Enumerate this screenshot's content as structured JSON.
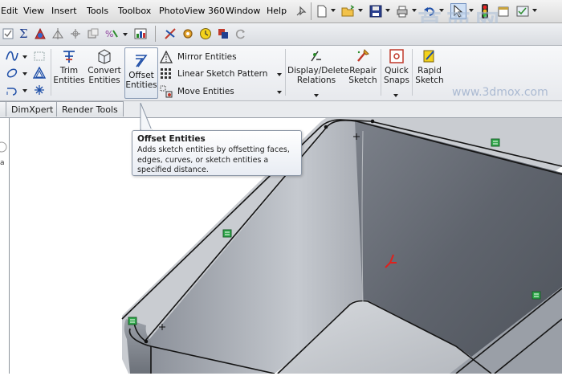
{
  "menubar": {
    "items": [
      "Edit",
      "View",
      "Insert",
      "Tools",
      "Toolbox",
      "PhotoView 360",
      "Window",
      "Help"
    ]
  },
  "command_manager": {
    "trim": [
      "Trim",
      "Entities"
    ],
    "convert": [
      "Convert",
      "Entities"
    ],
    "offset": [
      "Offset",
      "Entities"
    ],
    "mirror": "Mirror Entities",
    "linear_pattern": "Linear Sketch Pattern",
    "move": "Move Entities",
    "display_delete": [
      "Display/Delete",
      "Relations"
    ],
    "repair": [
      "Repair",
      "Sketch"
    ],
    "quick_snaps": [
      "Quick",
      "Snaps"
    ],
    "rapid": [
      "Rapid",
      "Sketch"
    ]
  },
  "tabs": [
    "DimXpert",
    "Render Tools"
  ],
  "tooltip": {
    "title": "Offset Entities",
    "body": [
      "Adds sketch entities by offsetting faces,",
      "edges, curves, or sketch entities a",
      "specified distance."
    ]
  },
  "watermark": {
    "line1": "莫西网",
    "line2": "www.3dmox.com"
  },
  "colors": {
    "face_dark": "#5e636c",
    "face_mid": "#a3a8b0",
    "face_light": "#c9ccd1",
    "relation_marker": "#2fa84a",
    "axis_red": "#e0201c"
  }
}
